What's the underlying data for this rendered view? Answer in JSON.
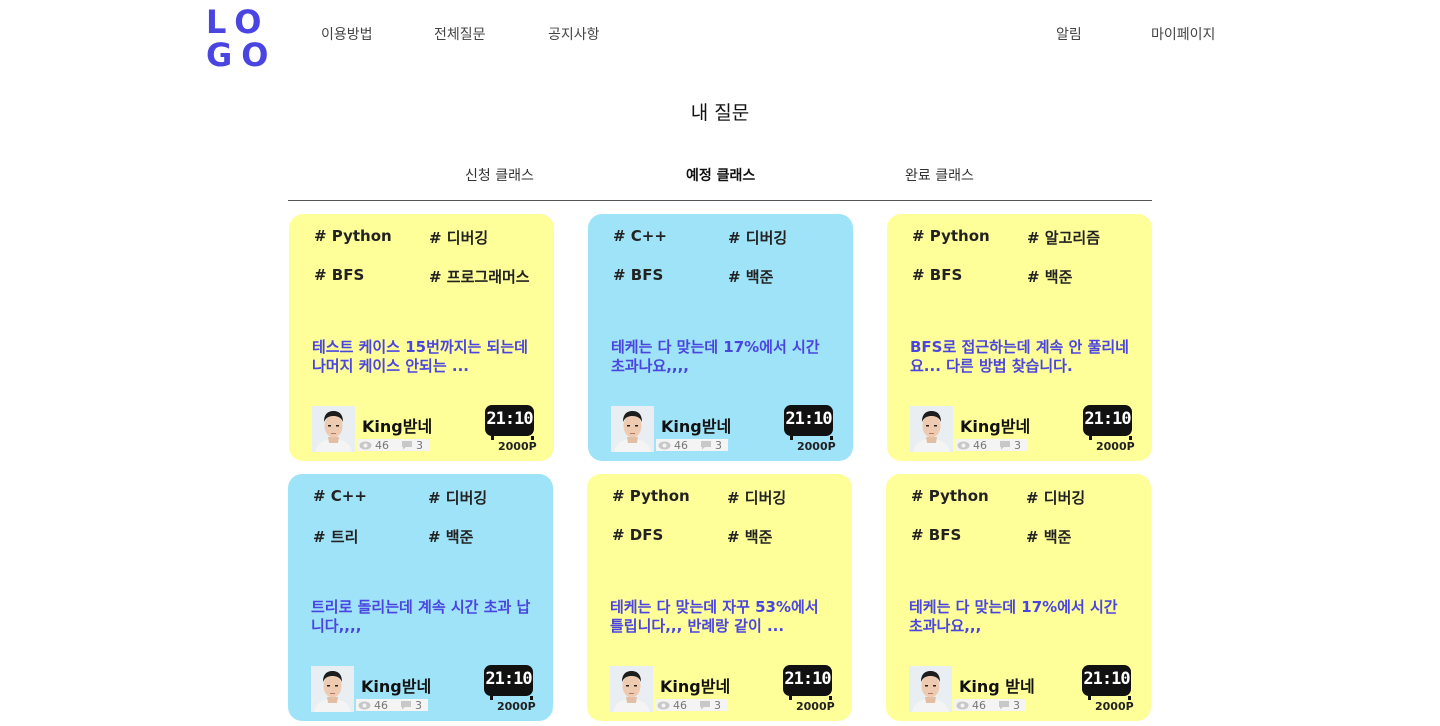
{
  "header": {
    "logo_line1": "LO",
    "logo_line2": "GO",
    "nav_left": [
      "이용방법",
      "전체질문",
      "공지사항"
    ],
    "nav_right": [
      "알림",
      "마이페이지"
    ]
  },
  "page": {
    "title": "내 질문"
  },
  "tabs": [
    {
      "label": "신청 클래스",
      "active": false
    },
    {
      "label": "예정 클래스",
      "active": true
    },
    {
      "label": "완료 클래스",
      "active": false
    }
  ],
  "cards": [
    {
      "color": "yellow",
      "tags": [
        "# Python",
        "# 디버깅",
        "# BFS",
        "# 프로그래머스"
      ],
      "question": "테스트 케이스 15번까지는 되는데 나머지 케이스 안되는 ...",
      "author": "King받네",
      "views": "46",
      "comments": "3",
      "timer": "21:10",
      "points": "2000P"
    },
    {
      "color": "blue",
      "tags": [
        "# C++",
        "# 디버깅",
        "# BFS",
        "# 백준"
      ],
      "question": "테케는 다 맞는데 17%에서 시간 초과나요,,,,",
      "author": "King받네",
      "views": "46",
      "comments": "3",
      "timer": "21:10",
      "points": "2000P"
    },
    {
      "color": "yellow",
      "tags": [
        "# Python",
        "# 알고리즘",
        "# BFS",
        "# 백준"
      ],
      "question": "BFS로 접근하는데 계속 안 풀리네요... 다른 방법 찾습니다.",
      "author": "King받네",
      "views": "46",
      "comments": "3",
      "timer": "21:10",
      "points": "2000P"
    },
    {
      "color": "blue",
      "tags": [
        "# C++",
        "# 디버깅",
        "# 트리",
        "# 백준"
      ],
      "question": "트리로 돌리는데 계속 시간 초과 납니다,,,,",
      "author": "King받네",
      "views": "46",
      "comments": "3",
      "timer": "21:10",
      "points": "2000P"
    },
    {
      "color": "yellow",
      "tags": [
        "# Python",
        "# 디버깅",
        "# DFS",
        "# 백준"
      ],
      "question": "테케는 다 맞는데 자꾸 53%에서 틀립니다,,, 반례랑 같이   ...",
      "author": "King받네",
      "views": "46",
      "comments": "3",
      "timer": "21:10",
      "points": "2000P"
    },
    {
      "color": "yellow",
      "tags": [
        "# Python",
        "# 디버깅",
        "# BFS",
        "# 백준"
      ],
      "question": "테케는 다 맞는데 17%에서 시간 초과나요,,,",
      "author": "King 받네",
      "views": "46",
      "comments": "3",
      "timer": "21:10",
      "points": "2000P"
    }
  ]
}
